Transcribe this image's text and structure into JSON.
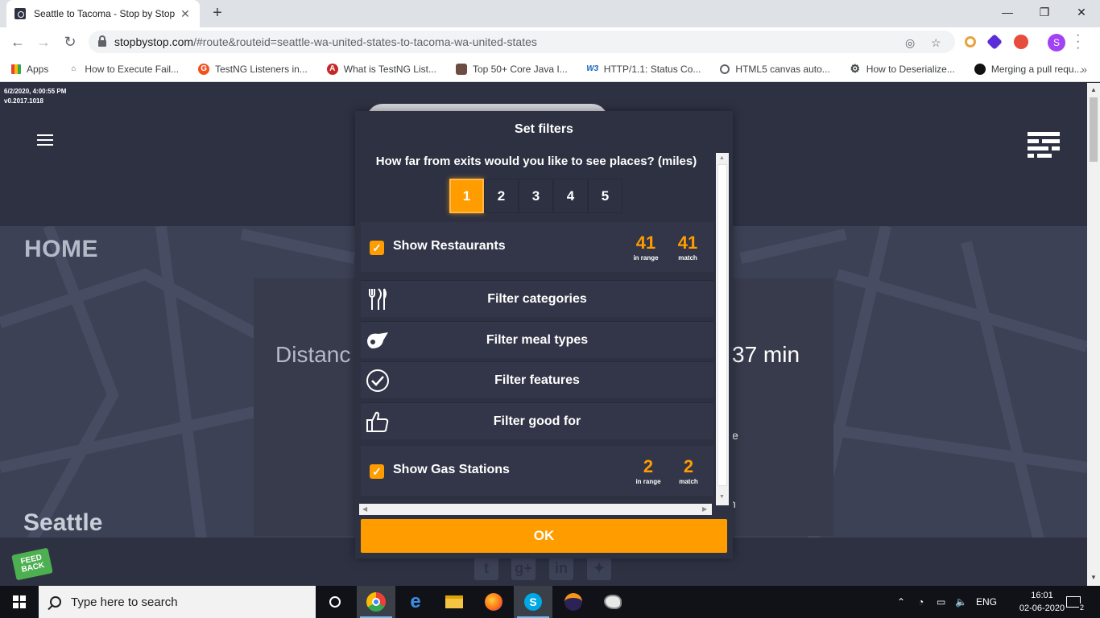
{
  "browser": {
    "tab_title": "Seattle to Tacoma - Stop by Stop",
    "url_host": "stopbystop.com",
    "url_path": "/#route&routeid=seattle-wa-united-states-to-tacoma-wa-united-states",
    "profile_initial": "S",
    "bookmarks": [
      {
        "label": "Apps",
        "icon": "apps-grid-icon"
      },
      {
        "label": "How to Execute Fail...",
        "icon": "page-icon"
      },
      {
        "label": "TestNG Listeners in...",
        "icon": "site-orange-icon"
      },
      {
        "label": "What is TestNG List...",
        "icon": "site-red-icon"
      },
      {
        "label": "Top 50+ Core Java I...",
        "icon": "site-box-icon"
      },
      {
        "label": "HTTP/1.1: Status Co...",
        "icon": "w3-icon"
      },
      {
        "label": "HTML5 canvas auto...",
        "icon": "globe-icon"
      },
      {
        "label": "How to Deserialize...",
        "icon": "gear-icon"
      },
      {
        "label": "Merging a pull requ...",
        "icon": "github-icon"
      }
    ]
  },
  "page": {
    "build_stamp": "6/2/2020, 4:00:55 PM",
    "version": "v0.2017.1018",
    "home_label": "HOME",
    "distance_fragment": "Distanc",
    "time_fragment": "37 min",
    "e_fragment": "e",
    "n_fragment": "n",
    "origin_label": "Seattle",
    "feedback_label_1": "FEED",
    "feedback_label_2": "BACK"
  },
  "modal": {
    "title": "Set filters",
    "distance_question": "How far from exits would you like to see places? (miles)",
    "mile_options": [
      "1",
      "2",
      "3",
      "4",
      "5"
    ],
    "selected_mile": "1",
    "restaurants": {
      "label": "Show Restaurants",
      "checked": true,
      "in_range": "41",
      "in_range_label": "in range",
      "match": "41",
      "match_label": "match"
    },
    "filters": [
      {
        "label": "Filter categories",
        "icon": "fork-knife-icon"
      },
      {
        "label": "Filter meal types",
        "icon": "meal-icon"
      },
      {
        "label": "Filter features",
        "icon": "check-circle-icon"
      },
      {
        "label": "Filter good for",
        "icon": "thumbs-up-icon"
      }
    ],
    "gas_stations": {
      "label": "Show Gas Stations",
      "checked": true,
      "in_range": "2",
      "in_range_label": "in range",
      "match": "2",
      "match_label": "match"
    },
    "ok_label": "OK"
  },
  "taskbar": {
    "search_placeholder": "Type here to search",
    "language": "ENG",
    "time": "16:01",
    "date": "02-06-2020",
    "notification_count": "2"
  },
  "colors": {
    "accent": "#ff9c00",
    "page_bg": "#2d3142",
    "map_bg": "#3d4155"
  }
}
